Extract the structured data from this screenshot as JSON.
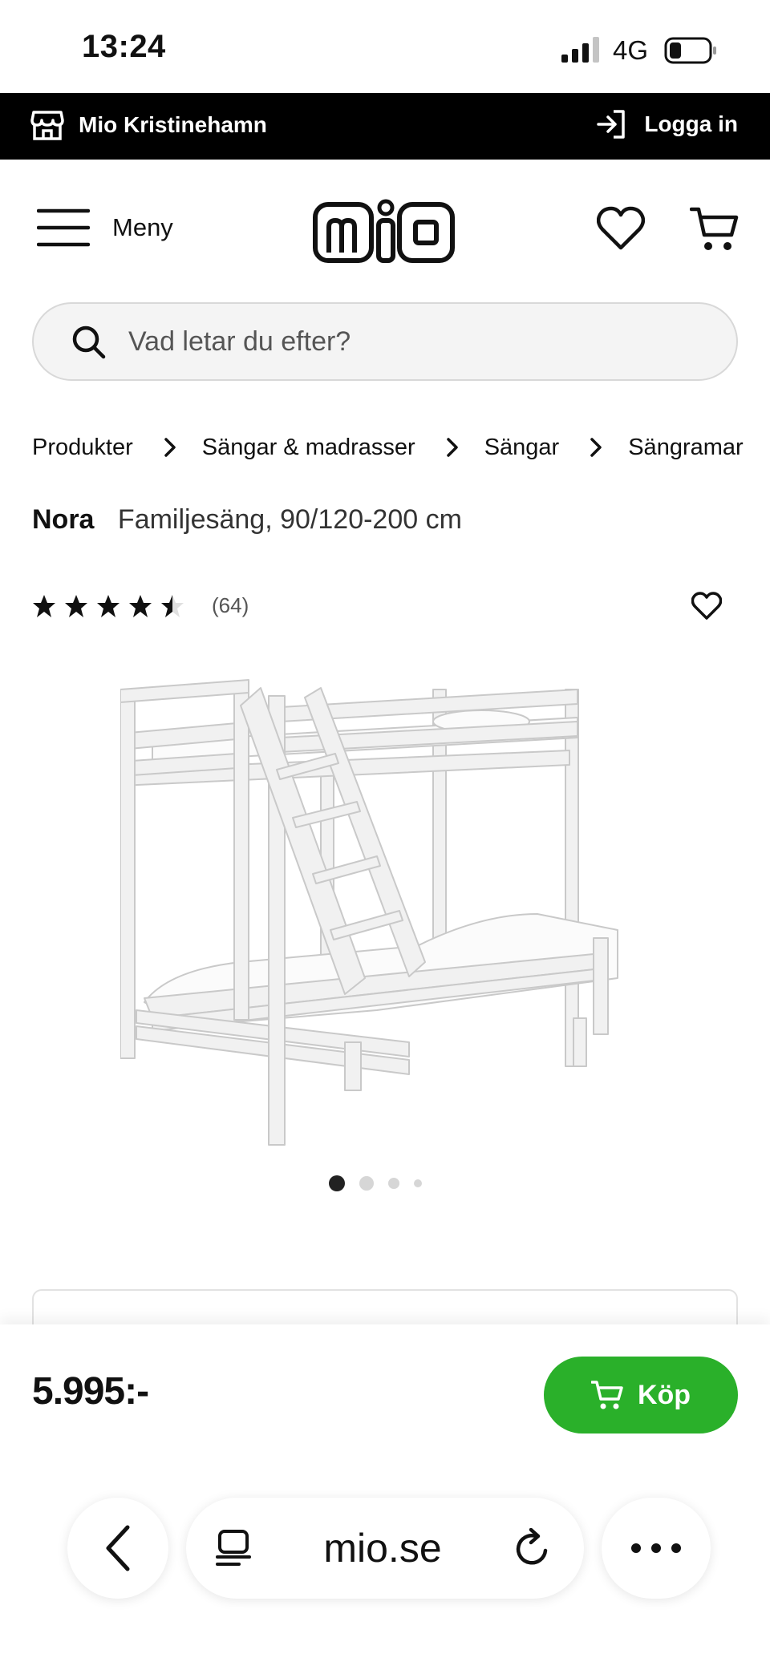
{
  "status_bar": {
    "time": "13:24",
    "network": "4G"
  },
  "store_bar": {
    "store_name": "Mio Kristinehamn",
    "login_label": "Logga in"
  },
  "header": {
    "menu_label": "Meny"
  },
  "search": {
    "placeholder": "Vad letar du efter?"
  },
  "breadcrumb": [
    "Produkter",
    "Sängar & madrasser",
    "Sängar",
    "Sängramar"
  ],
  "product": {
    "brand": "Nora",
    "description": "Familjesäng, 90/120-200 cm",
    "rating": 4.5,
    "rating_max": 5,
    "review_count": "(64)",
    "image_count": 4,
    "active_image": 1
  },
  "buy_bar": {
    "price": "5.995:-",
    "buy_label": "Köp"
  },
  "browser": {
    "url": "mio.se"
  },
  "colors": {
    "accent": "#2ab02a",
    "store_bar": "#000000"
  }
}
